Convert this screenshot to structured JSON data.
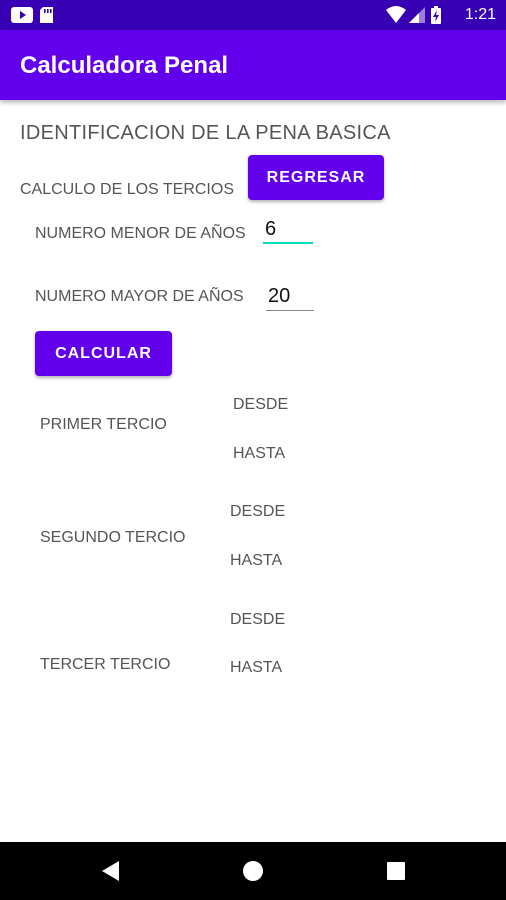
{
  "status_bar": {
    "time": "1:21",
    "icons": [
      "youtube-icon",
      "sd-card-icon",
      "wifi-icon",
      "signal-icon",
      "battery-charging-icon"
    ]
  },
  "app_bar": {
    "title": "Calculadora Penal"
  },
  "main": {
    "heading": "IDENTIFICACION DE LA PENA BASICA",
    "subheading": "CALCULO DE LOS TERCIOS",
    "regresar_label": "REGRESAR",
    "menor_label": "NUMERO MENOR DE AÑOS",
    "menor_value": "6",
    "mayor_label": "NUMERO MAYOR DE AÑOS",
    "mayor_value": "20",
    "calcular_label": "CALCULAR",
    "tercios": [
      {
        "label": "PRIMER TERCIO",
        "desde": "DESDE",
        "hasta": "HASTA"
      },
      {
        "label": "SEGUNDO TERCIO",
        "desde": "DESDE",
        "hasta": "HASTA"
      },
      {
        "label": "TERCER TERCIO",
        "desde": "DESDE",
        "hasta": "HASTA"
      }
    ]
  },
  "nav_bar": {
    "icons": [
      "back-icon",
      "home-icon",
      "recents-icon"
    ]
  },
  "colors": {
    "primary": "#6200ee",
    "primary_dark": "#3700b3",
    "accent": "#03dac5"
  }
}
